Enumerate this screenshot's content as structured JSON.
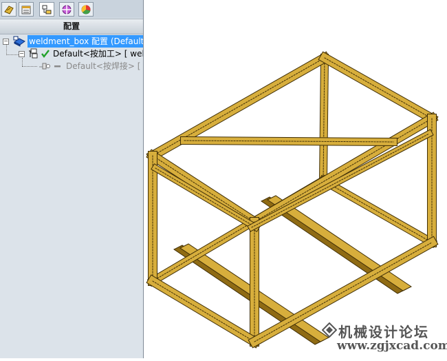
{
  "tabs": [
    {
      "icon": "feature-manager-icon",
      "active": false
    },
    {
      "icon": "property-manager-icon",
      "active": false
    },
    {
      "icon": "configuration-manager-icon",
      "active": true
    },
    {
      "icon": "dimxpert-manager-icon",
      "active": false
    },
    {
      "icon": "display-manager-icon",
      "active": false
    }
  ],
  "panel": {
    "title": "配置"
  },
  "tree": {
    "root": {
      "label": "weldment_box 配置  (Default"
    },
    "configs": [
      {
        "label": "Default<按加工>  [ weld",
        "status": "active"
      },
      {
        "label": "Default<按焊接>  [ w",
        "status": "inactive"
      }
    ]
  },
  "watermark": {
    "title": "机械设计论坛",
    "url": "www.zgjxcad.com"
  },
  "colors": {
    "frame_face": "#d7ae3c",
    "frame_dark": "#8f6b14",
    "frame_edge": "#3f2e06",
    "selection": "#3399ff"
  }
}
